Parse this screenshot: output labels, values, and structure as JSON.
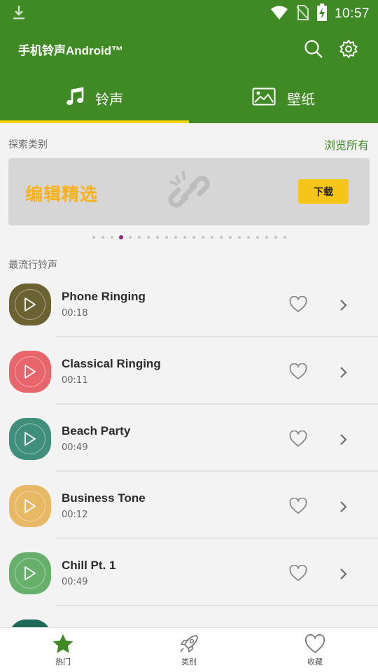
{
  "status_bar": {
    "time": "10:57",
    "icons": [
      "download-icon",
      "wifi-icon",
      "no-sim-icon",
      "battery-charging-icon"
    ]
  },
  "app_bar": {
    "title": "手机铃声Android™",
    "icons": [
      "search-icon",
      "settings-icon"
    ]
  },
  "tabs": [
    {
      "label": "铃声",
      "icon": "music-note-icon",
      "selected": true
    },
    {
      "label": "壁纸",
      "icon": "image-icon",
      "selected": false
    }
  ],
  "explore": {
    "label": "探索类别",
    "link": "浏览所有"
  },
  "banner": {
    "title": "编辑精选",
    "button": "下载",
    "page_count": 22,
    "active_page": 3
  },
  "popular": {
    "label": "最流行铃声",
    "items": [
      {
        "name": "Phone Ringing",
        "duration": "00:18",
        "color": "#6a6331"
      },
      {
        "name": "Classical Ringing",
        "duration": "00:11",
        "color": "#e8666b"
      },
      {
        "name": "Beach Party",
        "duration": "00:49",
        "color": "#3f8f7c"
      },
      {
        "name": "Business Tone",
        "duration": "00:12",
        "color": "#e8b865"
      },
      {
        "name": "Chill Pt. 1",
        "duration": "00:49",
        "color": "#66b06c"
      }
    ],
    "partial_item_color": "#1e6a5a"
  },
  "bottom_nav": [
    {
      "label": "热门",
      "icon": "star-icon",
      "active": true
    },
    {
      "label": "类别",
      "icon": "rocket-icon",
      "active": false
    },
    {
      "label": "收藏",
      "icon": "heart-icon",
      "active": false
    }
  ],
  "colors": {
    "primary": "#3f8a24",
    "accent": "#f5d200",
    "banner_title": "#f7b21b",
    "dot_active": "#8e2b6e"
  }
}
